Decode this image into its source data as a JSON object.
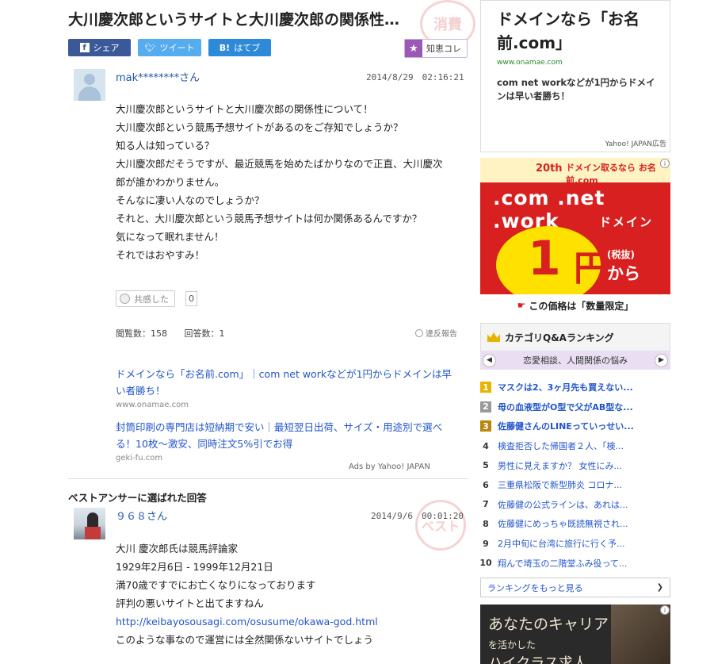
{
  "question": {
    "title": "大川慶次郎というサイトと大川慶次郎の関係性…",
    "share": {
      "facebook": "シェア",
      "twitter": "ツイート",
      "hatena": "はてブ",
      "hatena_mark": "B!"
    },
    "chie_kore": "知恵コレ",
    "user": "mak********さん",
    "timestamp": "2014/8/29　02:16:21",
    "body_lines": [
      "大川慶次郎というサイトと大川慶次郎の関係性について！",
      "大川慶次郎という競馬予想サイトがあるのをご存知でしょうか？",
      "知る人は知っている？",
      "大川慶次郎だそうですが、最近競馬を始めたばかりなので正直、大川慶次",
      "郎が誰かわかりません。",
      "そんなに凄い人なのでしょうか？",
      "それと、大川慶次郎という競馬予想サイトは何か関係あるんですか？",
      "気になって眠れません！",
      "それではおやすみ！"
    ],
    "kyokan_label": "共感した",
    "kyokan_count": "0",
    "views": "閲覧数：158",
    "answers": "回答数：1",
    "report": "違反報告"
  },
  "ads": [
    {
      "title": "ドメインなら「お名前.com」｜com net workなどが1円からドメインは早い者勝ち！",
      "url": "www.onamae.com"
    },
    {
      "title": "封筒印刷の専門店は短納期で安い｜最短翌日出荷、サイズ・用途別で選べる！10枚〜激安、同時注文5%引でお得",
      "url": "geki-fu.com"
    }
  ],
  "ads_by": "Ads by Yahoo! JAPAN",
  "best_answer": {
    "heading": "ベストアンサーに選ばれた回答",
    "user": "９６８さん",
    "timestamp": "2014/9/6　00:01:20",
    "line1": "大川 慶次郎氏は競馬評論家",
    "line2": "1929年2月6日 - 1999年12月21日",
    "line3": "満70歳ですでにお亡くなりになっております",
    "line4": "評判の悪いサイトと出てますねん",
    "link": "http://keibayosousagi.com/osusume/okawa-god.html",
    "line5": "このような事なので運営には全然関係ないサイトでしょう"
  },
  "stamps": {
    "top": "消費",
    "answer": "ベスト"
  },
  "sidebar": {
    "ad_top": {
      "headline": "ドメインなら「お名前.com」",
      "url": "www.onamae.com",
      "desc": "com net workなどが1円からドメインは早い者勝ち！",
      "label": "Yahoo! JAPAN広告"
    },
    "ad_red": {
      "badge": "20th",
      "brand": "ドメイン取るなら お名前.com",
      "tlds": ".com .net .work",
      "domain": "ドメイン",
      "price": "1",
      "yen": "円",
      "tax": "(税抜)",
      "kara": "から",
      "bottom": "この価格は「数量限定」"
    },
    "ranking": {
      "title": "カテゴリQ&Aランキング",
      "category": "恋愛相談、人間関係の悩み",
      "items": [
        {
          "num": "1",
          "text": "マスクは2、3ヶ月先も買えない..."
        },
        {
          "num": "2",
          "text": "母の血液型がO型で父がAB型な..."
        },
        {
          "num": "3",
          "text": "佐藤健さんのLINEっていっせい..."
        },
        {
          "num": "4",
          "text": "検査拒否した帰国者２人、「検..."
        },
        {
          "num": "5",
          "text": "男性に見えますか？ 女性にみ..."
        },
        {
          "num": "6",
          "text": "三重県松阪で新型肺炎 コロナ..."
        },
        {
          "num": "7",
          "text": "佐藤健の公式ラインは、あれは..."
        },
        {
          "num": "8",
          "text": "佐藤健にめっちゃ既読無視され..."
        },
        {
          "num": "9",
          "text": "2月中旬に台湾に旅行に行く予..."
        },
        {
          "num": "10",
          "text": "翔んで埼玉の二階堂ふみ役って..."
        }
      ],
      "more": "ランキングをもっと見る"
    },
    "ad_career": {
      "line1": "あなたのキャリア",
      "line2": "を活かした",
      "line3": "ハイクラス求人"
    }
  },
  "icons": {
    "facebook": "facebook-icon",
    "twitter": "twitter-icon",
    "hatena": "hatena-icon",
    "star": "star-icon",
    "crown": "crown-icon"
  }
}
